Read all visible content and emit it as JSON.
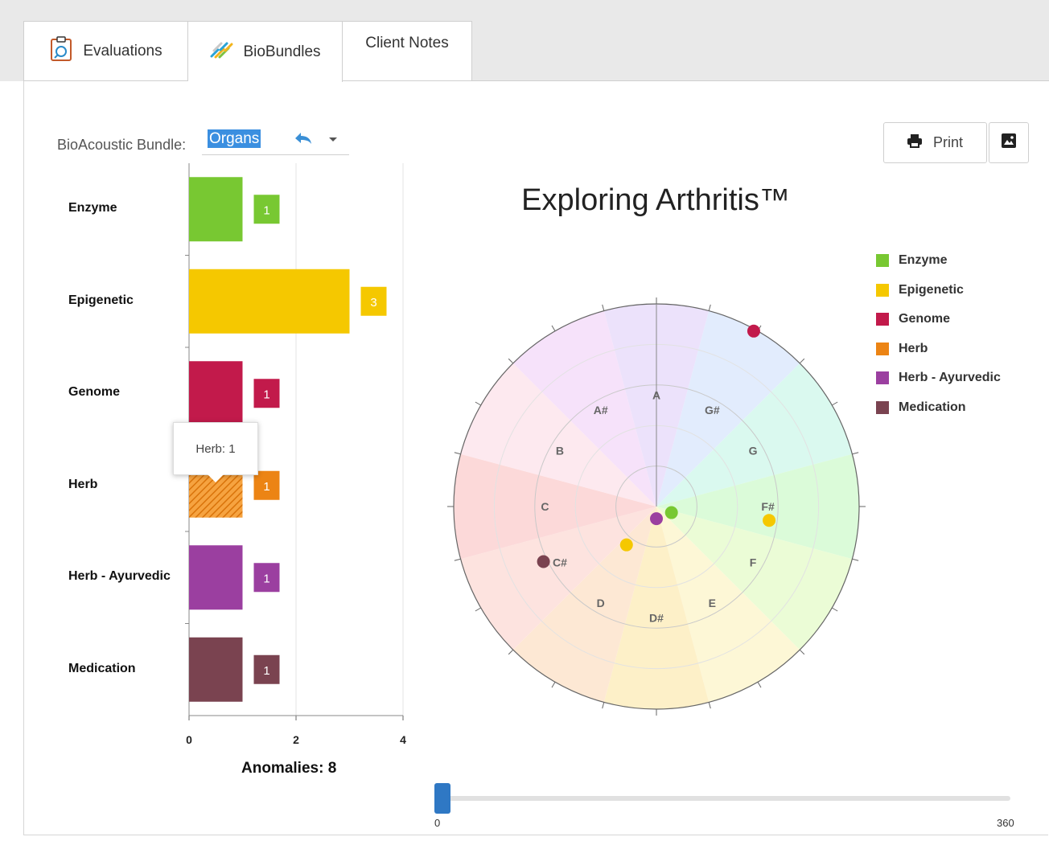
{
  "tabs": [
    {
      "label": "Evaluations",
      "icon": "magnifier-clipboard-icon"
    },
    {
      "label": "BioBundles",
      "icon": "biobundles-icon"
    },
    {
      "label": "Client Notes"
    }
  ],
  "active_tab": "BioBundles",
  "bundle": {
    "label": "BioAcoustic Bundle:",
    "value": "Organs"
  },
  "toolbar": {
    "print_label": "Print",
    "image_icon": "image-icon"
  },
  "bar_chart": {
    "type": "bar",
    "orientation": "horizontal",
    "categories": [
      "Enzyme",
      "Epigenetic",
      "Genome",
      "Herb",
      "Herb - Ayurvedic",
      "Medication"
    ],
    "values": [
      1,
      3,
      1,
      1,
      1,
      1
    ],
    "value_labels": [
      "1",
      "3",
      "1",
      "1",
      "1",
      "1"
    ],
    "colors": [
      "#78c832",
      "#f5c800",
      "#c21a4b",
      "#ec8414",
      "#9b3fa0",
      "#7a4350"
    ],
    "xticks": [
      "0",
      "2",
      "4"
    ],
    "xlim": [
      0,
      4
    ],
    "grid": true,
    "highlighted": "Herb",
    "footer": "Anomalies: 8"
  },
  "tooltip": "Herb: 1",
  "chart_data": [
    {
      "type": "bar",
      "categories": [
        "Enzyme",
        "Epigenetic",
        "Genome",
        "Herb",
        "Herb - Ayurvedic",
        "Medication"
      ],
      "values": [
        1,
        3,
        1,
        1,
        1,
        1
      ],
      "xlim": [
        0,
        4
      ],
      "xticks": [
        0,
        2,
        4
      ],
      "title": ""
    },
    {
      "type": "scatter",
      "title": "Exploring Arthritis™",
      "coordinate": "polar",
      "angle_range": [
        0,
        360
      ],
      "radial_range": [
        0,
        5
      ],
      "sectors": [
        "A",
        "G#",
        "G",
        "F#",
        "F",
        "E",
        "D#",
        "D",
        "C#",
        "C",
        "B",
        "A#"
      ],
      "sector_colors": [
        "#ece2fb",
        "#e2ecfd",
        "#daf9ef",
        "#dbfbd9",
        "#ebfcd6",
        "#fdf7d6",
        "#fdf0c8",
        "#fde8d4",
        "#fde3df",
        "#fcd9d9",
        "#fde9ef",
        "#f6e2fa"
      ],
      "legend": [
        "Enzyme",
        "Epigenetic",
        "Genome",
        "Herb",
        "Herb - Ayurvedic",
        "Medication"
      ],
      "legend_position": "right",
      "series": [
        {
          "name": "Enzyme",
          "color": "#78c832",
          "points": [
            {
              "angle": 112,
              "r": 0.4
            }
          ]
        },
        {
          "name": "Epigenetic",
          "color": "#f5c800",
          "points": [
            {
              "angle": 218,
              "r": 1.2
            },
            {
              "angle": 97,
              "r": 2.8
            }
          ]
        },
        {
          "name": "Genome",
          "color": "#c21a4b",
          "points": [
            {
              "angle": 29,
              "r": 4.95
            }
          ]
        },
        {
          "name": "Herb",
          "color": "#ec8414",
          "points": []
        },
        {
          "name": "Herb - Ayurvedic",
          "color": "#9b3fa0",
          "points": [
            {
              "angle": 180,
              "r": 0.3
            }
          ]
        },
        {
          "name": "Medication",
          "color": "#7a4350",
          "points": [
            {
              "angle": 244,
              "r": 3.1
            }
          ]
        }
      ]
    }
  ],
  "slider": {
    "min": "0",
    "max": "360",
    "value": 0
  }
}
